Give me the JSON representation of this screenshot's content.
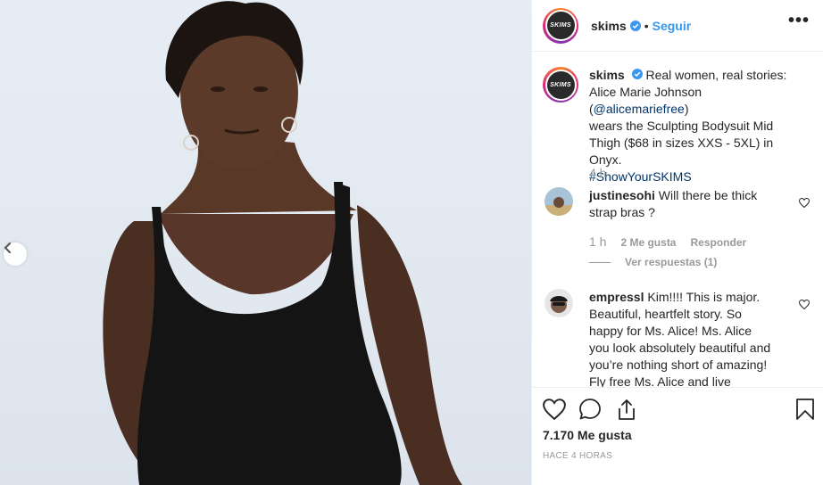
{
  "post": {
    "account": "skims",
    "avatar_text": "SKIMS",
    "follow_label": "Seguir",
    "separator": "•",
    "more_label": "•••",
    "caption": {
      "username": "skims",
      "line1": "Real women, real stories:",
      "line2_prefix": "Alice Marie Johnson (",
      "mention": "@alicemariefree",
      "line2_suffix": ")",
      "line3": "wears the Sculpting Bodysuit Mid",
      "line4": "Thigh ($68 in sizes XXS - 5XL) in Onyx.",
      "hashtag": "#ShowYourSKIMS",
      "time": "4 h"
    },
    "comments": [
      {
        "username": "justinesohi",
        "text": "Will there be thick strap bras ?",
        "time": "1 h",
        "likes": "2 Me gusta",
        "reply_label": "Responder",
        "view_replies": "Ver respuestas (1)"
      },
      {
        "username": "empressl",
        "text": "Kim!!!! This is major. Beautiful, heartfelt story. So happy for Ms. Alice! Ms. Alice you look absolutely beautiful and you’re nothing short of amazing! Fly free Ms. Alice and live"
      }
    ],
    "like_count": "7.170 Me gusta",
    "posted_ago": "HACE 4 HORAS"
  },
  "icons": {
    "verified": "verified-badge-icon",
    "prev": "chevron-left-icon",
    "like": "heart-icon",
    "comment": "comment-bubble-icon",
    "share": "share-icon",
    "save": "bookmark-icon"
  },
  "colors": {
    "accent_blue": "#3897f0",
    "link": "#003569",
    "muted": "#999999",
    "text": "#262626"
  }
}
